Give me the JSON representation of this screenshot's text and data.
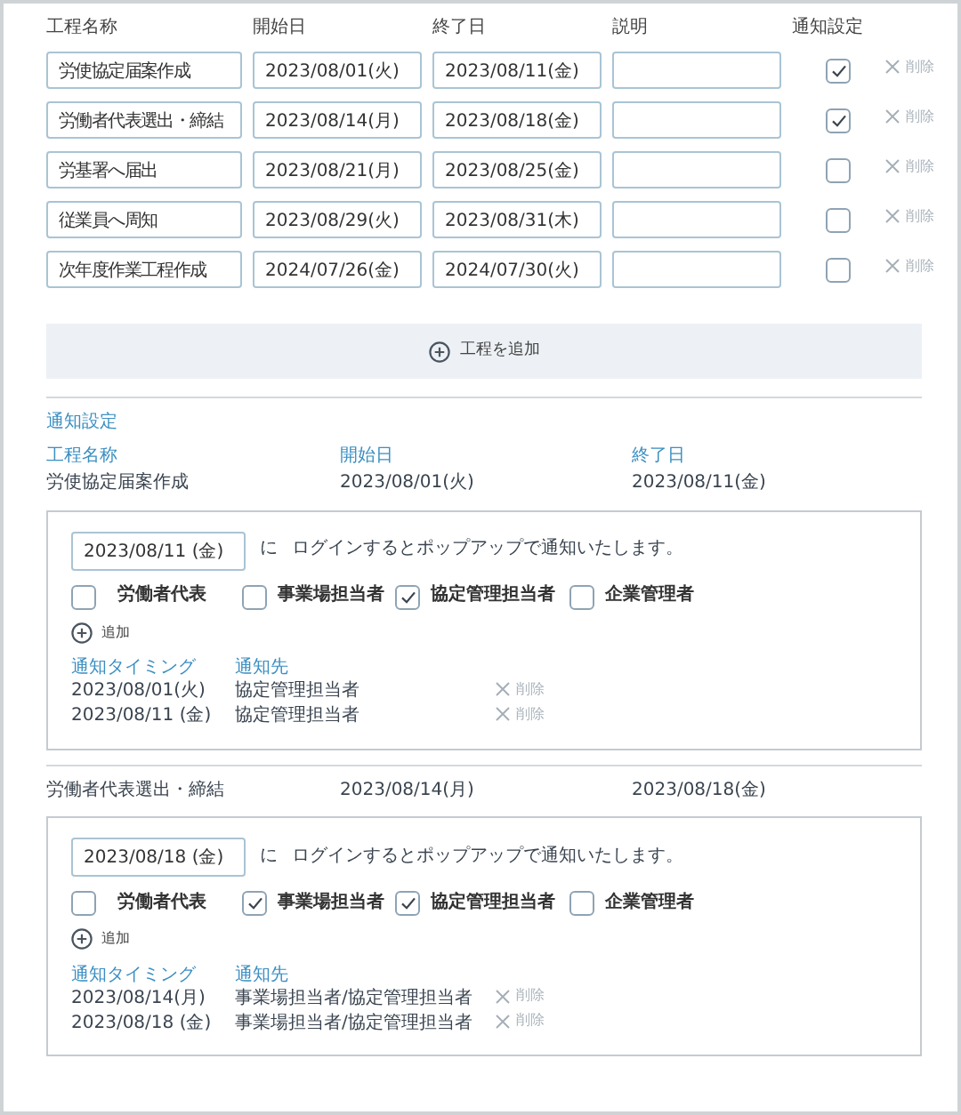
{
  "table": {
    "columns": [
      "工程名称",
      "開始日",
      "終了日",
      "説明",
      "通知設定"
    ],
    "rows": [
      {
        "name": "労使協定届案作成",
        "start": "2023/08/01(火)",
        "end": "2023/08/11(金)",
        "notify": true,
        "delete_label": "削除"
      },
      {
        "name": "労働者代表選出・締結",
        "start": "2023/08/14(月)",
        "end": "2023/08/18(金)",
        "notify": true,
        "delete_label": "削除"
      },
      {
        "name": "労基署へ届出",
        "start": "2023/08/21(月)",
        "end": "2023/08/25(金)",
        "notify": false,
        "delete_label": "削除"
      },
      {
        "name": "従業員へ周知",
        "start": "2023/08/29(火)",
        "end": "2023/08/31(木)",
        "notify": false,
        "delete_label": "削除"
      },
      {
        "name": "次年度作業工程作成",
        "start": "2024/07/26(金)",
        "end": "2024/07/30(火)",
        "notify": false,
        "delete_label": "削除"
      }
    ]
  },
  "add_step_button": {
    "label": "工程を追加"
  },
  "notification_settings": {
    "title": "通知設定",
    "items": [
      {
        "labels": [
          "工程名称",
          "開始日",
          "終了日"
        ],
        "name": "労使協定届案作成",
        "start": "2023/08/01(火)",
        "end": "2023/08/11(金)",
        "date_value": "2023/08/11 (金)",
        "connector": "に",
        "message": "ログインするとポップアップで通知いたします。",
        "recipients": [
          {
            "label": "労働者代表",
            "checked": false
          },
          {
            "label": "事業場担当者",
            "checked": false
          },
          {
            "label": "協定管理担当者",
            "checked": true
          },
          {
            "label": "企業管理者",
            "checked": false
          }
        ],
        "add_label": "追加",
        "timing_header": "通知タイミング",
        "recipients_header": "通知先",
        "entries": [
          {
            "timing": "2023/08/01(火)",
            "recipients": "協定管理担当者",
            "delete_label": "削除"
          },
          {
            "timing": "2023/08/11 (金)",
            "recipients": "協定管理担当者",
            "delete_label": "削除"
          }
        ]
      },
      {
        "name": "労働者代表選出・締結",
        "start": "2023/08/14(月)",
        "end": "2023/08/18(金)",
        "date_value": "2023/08/18 (金)",
        "connector": "に",
        "message": "ログインするとポップアップで通知いたします。",
        "recipients": [
          {
            "label": "労働者代表",
            "checked": false
          },
          {
            "label": "事業場担当者",
            "checked": true
          },
          {
            "label": "協定管理担当者",
            "checked": true
          },
          {
            "label": "企業管理者",
            "checked": false
          }
        ],
        "add_label": "追加",
        "timing_header": "通知タイミング",
        "recipients_header": "通知先",
        "entries": [
          {
            "timing": "2023/08/14(月)",
            "recipients": "事業場担当者/協定管理担当者",
            "delete_label": "削除"
          },
          {
            "timing": "2023/08/18 (金)",
            "recipients": "事業場担当者/協定管理担当者",
            "delete_label": "削除"
          }
        ]
      }
    ]
  }
}
